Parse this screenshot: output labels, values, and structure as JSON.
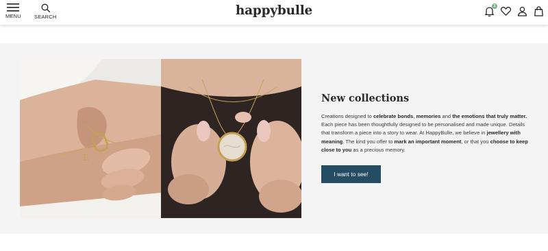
{
  "header": {
    "menu_label": "MENU",
    "search_label": "SEARCH",
    "logo_text": "happybulle",
    "notification_count": "1"
  },
  "banner": {
    "title_regular": "New ",
    "title_bold": "collections",
    "paragraph": [
      {
        "t": "Creations designed to ",
        "b": false
      },
      {
        "t": "celebrate bonds",
        "b": true
      },
      {
        "t": ", ",
        "b": false
      },
      {
        "t": "memories",
        "b": true
      },
      {
        "t": " and ",
        "b": false
      },
      {
        "t": "the emotions that truly matter.",
        "b": true
      },
      {
        "t": " Each piece has been thoughtfully designed to be personalised and made unique. Details that transform a piece into a story to wear. At HappyBulle, we believe in ",
        "b": false
      },
      {
        "t": "jewellery with meaning",
        "b": true
      },
      {
        "t": ". The kind you offer to ",
        "b": false
      },
      {
        "t": "mark an important moment",
        "b": true
      },
      {
        "t": ", or that you ",
        "b": false
      },
      {
        "t": "choose to keep close to you",
        "b": true
      },
      {
        "t": " as a precious memory.",
        "b": false
      }
    ],
    "cta_label": "I want to see!"
  },
  "colors": {
    "accent": "#244c62",
    "badge": "#7bb38a",
    "banner_bg": "#f4f4f4"
  },
  "icons": [
    "menu-icon",
    "search-icon",
    "bell-icon",
    "heart-icon",
    "user-icon",
    "bag-icon"
  ]
}
